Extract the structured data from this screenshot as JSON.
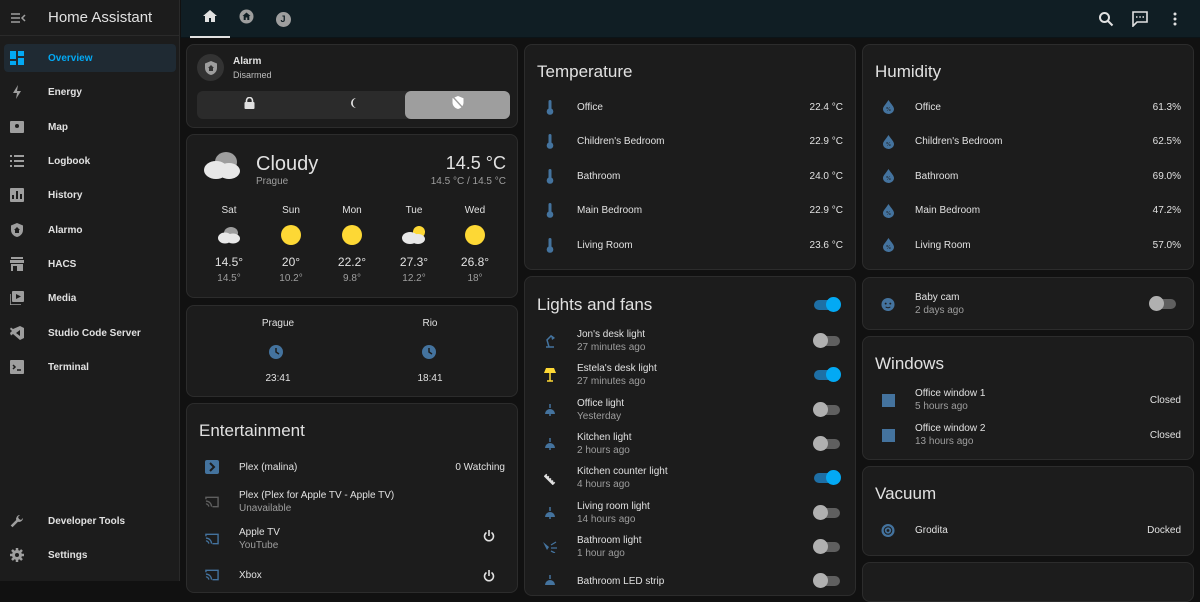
{
  "app": {
    "title": "Home Assistant"
  },
  "sidebar": {
    "items": [
      {
        "label": "Overview",
        "icon": "dashboard-icon",
        "active": true
      },
      {
        "label": "Energy",
        "icon": "lightning-icon"
      },
      {
        "label": "Map",
        "icon": "map-icon"
      },
      {
        "label": "Logbook",
        "icon": "list-icon"
      },
      {
        "label": "History",
        "icon": "chart-icon"
      },
      {
        "label": "Alarmo",
        "icon": "shield-home-icon"
      },
      {
        "label": "HACS",
        "icon": "store-icon"
      },
      {
        "label": "Media",
        "icon": "play-icon"
      },
      {
        "label": "Studio Code Server",
        "icon": "vscode-icon"
      },
      {
        "label": "Terminal",
        "icon": "console-icon"
      }
    ],
    "bottom": [
      {
        "label": "Developer Tools",
        "icon": "wrench-icon"
      },
      {
        "label": "Settings",
        "icon": "cog-icon"
      }
    ]
  },
  "topbar": {
    "tab_icons": [
      "home-icon",
      "home-circle-icon",
      "avatar-j-icon"
    ],
    "avatar_letter": "J"
  },
  "alarm": {
    "name": "Alarm",
    "state": "Disarmed"
  },
  "weather": {
    "condition": "Cloudy",
    "location": "Prague",
    "temp": "14.5 °C",
    "range": "14.5 °C / 14.5 °C",
    "forecast": [
      {
        "day": "Sat",
        "icon": "cloud",
        "high": "14.5°",
        "low": "14.5°"
      },
      {
        "day": "Sun",
        "icon": "sun",
        "high": "20°",
        "low": "10.2°"
      },
      {
        "day": "Mon",
        "icon": "sun",
        "high": "22.2°",
        "low": "9.8°"
      },
      {
        "day": "Tue",
        "icon": "partly",
        "high": "27.3°",
        "low": "12.2°"
      },
      {
        "day": "Wed",
        "icon": "sun",
        "high": "26.8°",
        "low": "18°"
      }
    ]
  },
  "clocks": [
    {
      "city": "Prague",
      "time": "23:41"
    },
    {
      "city": "Rio",
      "time": "18:41"
    }
  ],
  "entertainment": {
    "title": "Entertainment",
    "items": [
      {
        "name": "Plex (malina)",
        "sub": "",
        "value": "0 Watching"
      },
      {
        "name": "Plex (Plex for Apple TV - Apple TV)",
        "sub": "Unavailable",
        "value": ""
      },
      {
        "name": "Apple TV",
        "sub": "YouTube",
        "value": ""
      },
      {
        "name": "Xbox",
        "sub": "",
        "value": ""
      }
    ]
  },
  "temperature": {
    "title": "Temperature",
    "rows": [
      {
        "name": "Office",
        "value": "22.4 °C"
      },
      {
        "name": "Children's Bedroom",
        "value": "22.9 °C"
      },
      {
        "name": "Bathroom",
        "value": "24.0 °C"
      },
      {
        "name": "Main Bedroom",
        "value": "22.9 °C"
      },
      {
        "name": "Living Room",
        "value": "23.6 °C"
      }
    ]
  },
  "lights": {
    "title": "Lights and fans",
    "master_on": true,
    "rows": [
      {
        "name": "Jon's desk light",
        "sub": "27 minutes ago",
        "on": false,
        "icon": "desk-lamp-icon"
      },
      {
        "name": "Estela's desk light",
        "sub": "27 minutes ago",
        "on": true,
        "icon": "lamp-icon"
      },
      {
        "name": "Office light",
        "sub": "Yesterday",
        "on": false,
        "icon": "ceiling-light-icon"
      },
      {
        "name": "Kitchen light",
        "sub": "2 hours ago",
        "on": false,
        "icon": "ceiling-light-icon"
      },
      {
        "name": "Kitchen counter light",
        "sub": "4 hours ago",
        "on": true,
        "icon": "led-strip-icon"
      },
      {
        "name": "Living room light",
        "sub": "14 hours ago",
        "on": false,
        "icon": "ceiling-light-icon"
      },
      {
        "name": "Bathroom light",
        "sub": "1 hour ago",
        "on": false,
        "icon": "spotlight-icon"
      },
      {
        "name": "Bathroom LED strip",
        "sub": "",
        "on": false,
        "icon": "led-strip-icon"
      }
    ]
  },
  "humidity": {
    "title": "Humidity",
    "rows": [
      {
        "name": "Office",
        "value": "61.3%"
      },
      {
        "name": "Children's Bedroom",
        "value": "62.5%"
      },
      {
        "name": "Bathroom",
        "value": "69.0%"
      },
      {
        "name": "Main Bedroom",
        "value": "47.2%"
      },
      {
        "name": "Living Room",
        "value": "57.0%"
      }
    ]
  },
  "babycam": {
    "name": "Baby cam",
    "sub": "2 days ago",
    "on": false
  },
  "windows": {
    "title": "Windows",
    "rows": [
      {
        "name": "Office window 1",
        "sub": "5 hours ago",
        "value": "Closed"
      },
      {
        "name": "Office window 2",
        "sub": "13 hours ago",
        "value": "Closed"
      }
    ]
  },
  "vacuum": {
    "title": "Vacuum",
    "name": "Grodita",
    "value": "Docked"
  },
  "colors": {
    "accent": "#03a9f4",
    "icon": "#44739e",
    "sun": "#fdd835"
  }
}
